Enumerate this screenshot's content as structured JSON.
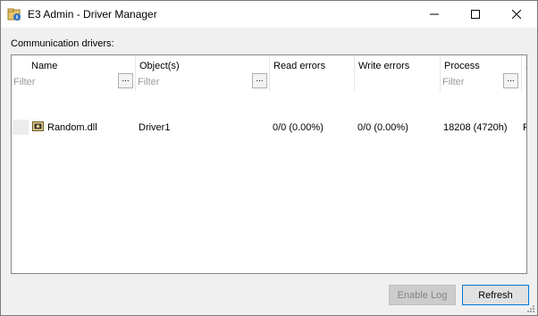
{
  "window": {
    "title": "E3 Admin - Driver Manager"
  },
  "section_label": "Communication drivers:",
  "columns": [
    {
      "name": "Name",
      "filter": "Filter",
      "has_filter_button": true
    },
    {
      "name": "Object(s)",
      "filter": "Filter",
      "has_filter_button": true
    },
    {
      "name": "Read errors",
      "filter": "",
      "has_filter_button": false
    },
    {
      "name": "Write errors",
      "filter": "",
      "has_filter_button": false
    },
    {
      "name": "Process",
      "filter": "Filter",
      "has_filter_button": true
    },
    {
      "name": "S",
      "filter": "",
      "has_filter_button": false
    }
  ],
  "filter_button_label": "...",
  "rows": [
    {
      "name": "Random.dll",
      "objects": "Driver1",
      "read_errors": "0/0 (0.00%)",
      "write_errors": "0/0 (0.00%)",
      "process": "18208 (4720h)",
      "extra": "R"
    }
  ],
  "buttons": {
    "enable_log": "Enable Log",
    "refresh": "Refresh"
  },
  "colors": {
    "focus_border": "#0078d7",
    "disabled_bg": "#cccccc",
    "disabled_text": "#838383"
  }
}
